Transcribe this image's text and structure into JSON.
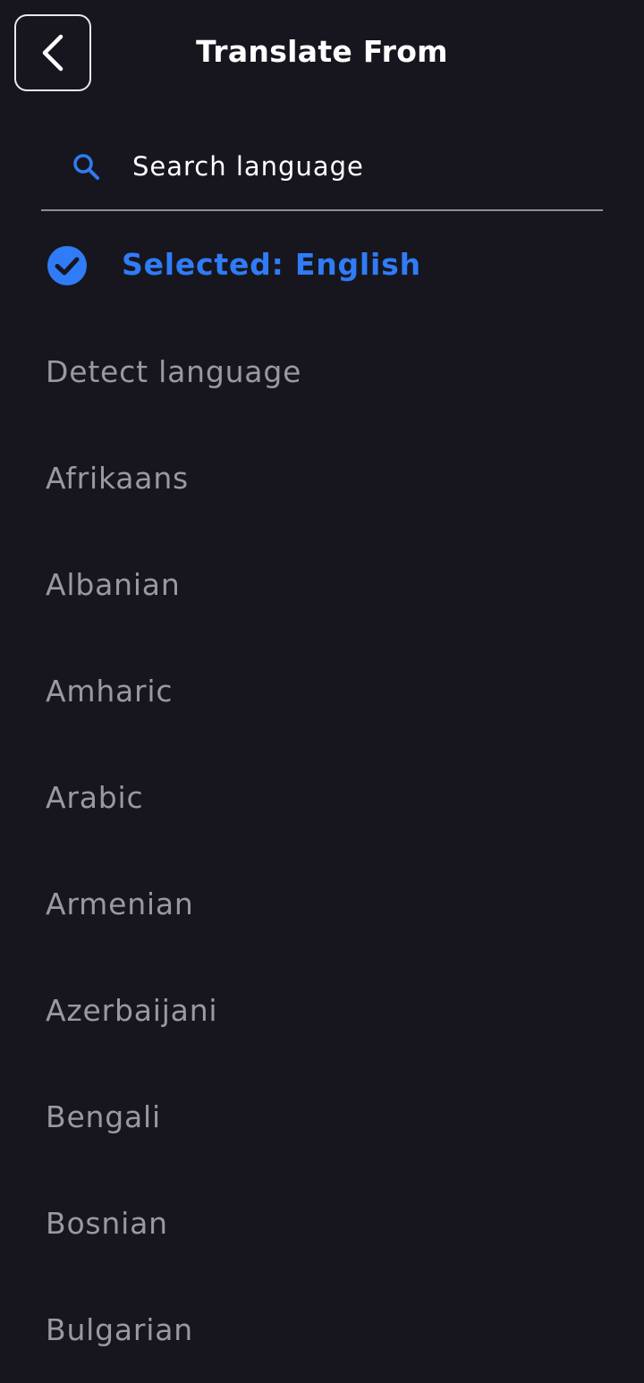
{
  "header": {
    "title": "Translate From",
    "back_icon": "chevron-left-icon"
  },
  "search": {
    "placeholder": "Search language",
    "value": "",
    "icon": "search-icon",
    "icon_color": "#2f7cf6"
  },
  "selected": {
    "label": "Selected: English",
    "icon": "check-circle-icon",
    "color": "#2f7cf6"
  },
  "languages": [
    "Detect language",
    "Afrikaans",
    "Albanian",
    "Amharic",
    "Arabic",
    "Armenian",
    "Azerbaijani",
    "Bengali",
    "Bosnian",
    "Bulgarian"
  ],
  "colors": {
    "background": "#17161f",
    "accent": "#2f7cf6",
    "list_text": "#9a99a1"
  }
}
